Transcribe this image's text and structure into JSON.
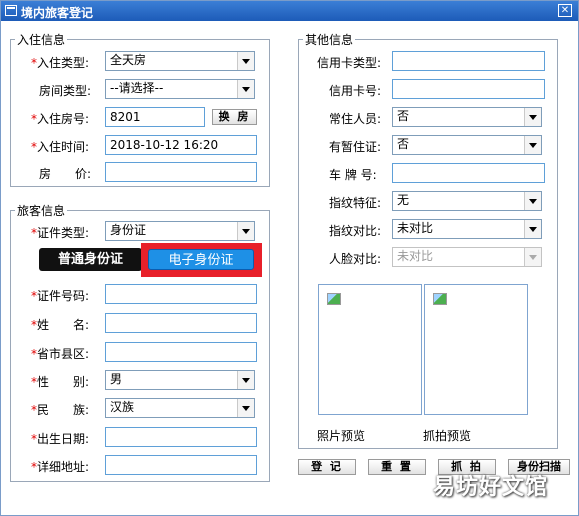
{
  "window": {
    "title": "境内旅客登记",
    "close_glyph": "✕"
  },
  "checkin": {
    "legend": "入住信息",
    "type_label": "入住类型:",
    "type_value": "全天房",
    "roomtype_label": "房间类型:",
    "roomtype_value": "--请选择--",
    "room_label": "入住房号:",
    "room_value": "8201",
    "change_room": "换 房",
    "time_label": "入住时间:",
    "time_value": "2018-10-12 16:20",
    "price_label": "房　　价:",
    "price_value": ""
  },
  "guest": {
    "legend": "旅客信息",
    "idtype_label": "证件类型:",
    "idtype_value": "身份证",
    "tab_normal": "普通身份证",
    "tab_electronic": "电子身份证",
    "idnum_label": "证件号码:",
    "name_label": "姓　　名:",
    "region_label": "省市县区:",
    "gender_label": "性　　别:",
    "gender_value": "男",
    "ethnic_label": "民　　族:",
    "ethnic_value": "汉族",
    "birth_label": "出生日期:",
    "address_label": "详细地址:"
  },
  "other": {
    "legend": "其他信息",
    "cardtype_label": "信用卡类型:",
    "cardnum_label": "信用卡号:",
    "resident_label": "常住人员:",
    "resident_value": "否",
    "permit_label": "有暂住证:",
    "permit_value": "否",
    "plate_label": "车 牌 号:",
    "finger_label": "指纹特征:",
    "finger_value": "无",
    "fingercmp_label": "指纹对比:",
    "fingercmp_value": "未对比",
    "facecmp_label": "人脸对比:",
    "facecmp_value": "未对比",
    "photo_preview": "照片预览",
    "capture_preview": "抓拍预览"
  },
  "buttons": {
    "register": "登 记",
    "reset": "重 置",
    "capture": "抓 拍",
    "scan": "身份扫描"
  },
  "watermark": "易坊好文馆"
}
